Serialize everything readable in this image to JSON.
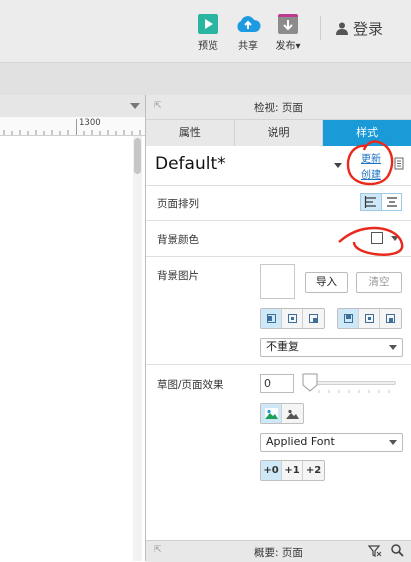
{
  "toolbar": {
    "preview_label": "预览",
    "share_label": "共享",
    "publish_label": "发布▾",
    "login_label": "登录"
  },
  "ruler": {
    "tick_label": "1300"
  },
  "panel": {
    "title": "检视: 页面",
    "tabs": [
      {
        "label": "属性",
        "active": false
      },
      {
        "label": "说明",
        "active": false
      },
      {
        "label": "样式",
        "active": true
      }
    ],
    "style_name": "Default*",
    "update_link": "更新",
    "create_link": "创建",
    "page_arrange_label": "页面排列",
    "bg_color_label": "背景颜色",
    "bg_image_label": "背景图片",
    "import_button": "导入",
    "clear_button": "清空",
    "repeat_select": "不重复",
    "sketch_label": "草图/页面效果",
    "sketch_value": "0",
    "font_select": "Applied Font",
    "font_adjust": [
      "+0",
      "+1",
      "+2"
    ]
  },
  "bottom_bar": {
    "title": "概要: 页面"
  },
  "colors": {
    "accent": "#1a9ad6",
    "annotation": "#e8291c",
    "preview_icon": "#2bb5a0",
    "share_icon": "#1e9be0",
    "publish_icon": "#8c8c8c"
  }
}
